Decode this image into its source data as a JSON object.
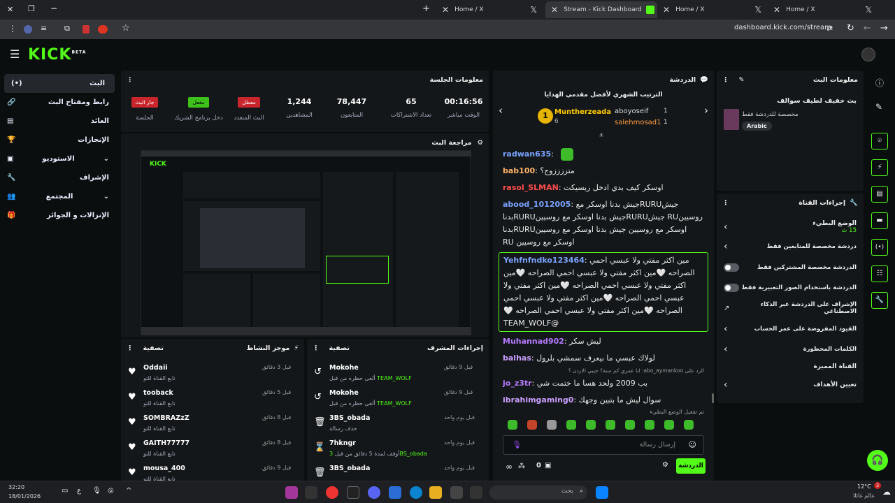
{
  "browser": {
    "tabs": [
      {
        "label": "Home / X"
      },
      {
        "label": "Stream - Kick Dashboard"
      },
      {
        "label": "Home / X"
      },
      {
        "label": "Home / X"
      }
    ],
    "url": "dashboard.kick.com/stream"
  },
  "kick": {
    "logo": "KICK",
    "logo_sup": "BETA"
  },
  "nav": [
    {
      "label": "البث",
      "icon": "broadcast-icon",
      "active": true
    },
    {
      "label": "رابط ومفتاح البث",
      "icon": "link-icon"
    },
    {
      "label": "العائد",
      "icon": "money-icon"
    },
    {
      "label": "الإنجازات",
      "icon": "trophy-icon"
    },
    {
      "label": "الاستوديو",
      "icon": "studio-icon"
    },
    {
      "label": "الإشراف",
      "icon": "wrench-icon"
    },
    {
      "label": "المجتمع",
      "icon": "community-icon"
    },
    {
      "label": "الإنزالات و الجوائز",
      "icon": "gift-icon"
    }
  ],
  "session": {
    "title": "معلومات الجلسة",
    "stats": [
      {
        "value": "00:16:56",
        "label": "الوقت مباشر"
      },
      {
        "value": "65",
        "label": "تعداد الاشتراكات"
      },
      {
        "value": "78,447",
        "label": "المتابعون"
      },
      {
        "value": "1,244",
        "label": "المشاهدين"
      },
      {
        "badge": "معطل",
        "label": "البث المتعدد"
      },
      {
        "badge": "مفعل",
        "label": "دخل برنامج الشريك"
      },
      {
        "badge": "جار البث",
        "label": "الجلسة"
      }
    ]
  },
  "preview": {
    "title": "مراجعة البث"
  },
  "chat": {
    "title": "الدردشة",
    "leaderboard_title": "الترتيب الشهري لأفضل مقدمي الهدايا",
    "leaders": [
      {
        "name": "Muntherzeada",
        "count": "6",
        "rank": "1"
      },
      {
        "name": "aboyoseif",
        "count": "1"
      },
      {
        "name": "salehmosad1",
        "count": "1"
      }
    ],
    "messages": [
      {
        "user": "radwan635",
        "color": "#7aa2ff",
        "text": ""
      },
      {
        "user": "bab100",
        "color": "#ffb36b",
        "text": "متززززوج؟"
      },
      {
        "user": "rasol_SLMAN",
        "color": "#ff4d4d",
        "text": "اوسكر كيف بدي ادخل ريسيكت"
      },
      {
        "user": "abood_1012005",
        "color": "#7aa2ff",
        "text": "جيشRURUجيش بدنا اوسكر مع روسيينRU جيشRURUجيش بدنا اوسكر مع روسيينRURUبدنا اوسكر مع روسيين جيش بدنا اوسكر مع روسيينRURUبدنا اوسكر مع روسيين RU"
      },
      {
        "user": "Yehfnfndko123464",
        "color": "#7aa2ff",
        "text": "مين اكثر مفتي ولا عبسي احمي الصراحه 🤍مين اكثر مفتي ولا عبسي احمي الصراحه 🤍مين اكثر مفتي ولا عبسي احمي الصراحه 🤍مين اكثر مفتي ولا عبسي احمي الصراحه 🤍مين اكثر مفتي ولا عبسي احمي الصراحه 🤍مين اكثر مفتي ولا عبسي احمي الصراحه 🤍 @TEAM_WOLF",
        "highlight": true
      },
      {
        "user": "Muhannad902",
        "color": "#b57bff",
        "text": "ليش سكر"
      },
      {
        "user": "balhas",
        "color": "#c9a0ff",
        "text": "لولاك عبسي ما بيعرف سمشي بلرول"
      },
      {
        "user": "jo_z3tr",
        "color": "#b57bff",
        "text": "بب 2009 ولحد هسا ما ختمت شي",
        "reply": "الرد على abo_aymankoo: انا عمري كم سنة؟ جيبي الاردن ؟"
      },
      {
        "user": "ibrahimgaming0",
        "color": "#c9a0ff",
        "text": "سوال ليش ما بتبين وجهك"
      }
    ],
    "slowmode_note": "تم تفعيل الوضع البطيء",
    "input_placeholder": "إرسال رسالة",
    "send_label": "الدردشة",
    "count": "0"
  },
  "stream_info": {
    "title": "معلومات البث",
    "stream_title": "بث خفيف لطيف سوالف",
    "category": "مخصصة للدردشة فقط",
    "language": "Arabic"
  },
  "channel_actions": {
    "title": "إجراءات القناة",
    "slow_mode": "الوضع البطيء",
    "slow_value": "15 ث",
    "items": [
      {
        "label": "دردشة مخصصة للمتابعين فقط",
        "type": "chevron"
      },
      {
        "label": "الدردشة مخصصة المشتركين فقط",
        "type": "switch"
      },
      {
        "label": "الدردشة باستخدام الصور التعبيرية فقط",
        "type": "switch"
      },
      {
        "label": "الإشراف على الدردشة عبر الذكاء الاصطناعي",
        "type": "external"
      },
      {
        "label": "القيود المفروضة على عمر الحساب",
        "type": "chevron"
      },
      {
        "label": "الكلمات المحظورة",
        "type": "chevron"
      }
    ],
    "goals_section": "القناة المميزة",
    "goals": "تعيين الأهداف"
  },
  "mod_actions": {
    "title": "إجراءات المشرف",
    "filter": "تصفية",
    "items": [
      {
        "user": "Mokohe",
        "desc": "ألغى حظره من قبل",
        "by": "TEAM_WOLF",
        "time": "قبل 9 دقائق",
        "icon": "undo-icon"
      },
      {
        "user": "Mokohe",
        "desc": "ألغى حظره من قبل",
        "by": "TEAM_WOLF",
        "time": "قبل 9 دقائق",
        "icon": "undo-icon"
      },
      {
        "user": "3BS_obada",
        "desc": "حذف رسالة",
        "by": "",
        "time": "قبل يوم واحد",
        "icon": "trash-icon"
      },
      {
        "user": "7hkngr",
        "desc": "أوقف لمدة 5 دقائق من قبل",
        "by": "3BS_obada",
        "time": "قبل يوم واحد",
        "icon": "hourglass-icon"
      },
      {
        "user": "3BS_obada",
        "desc": "",
        "by": "",
        "time": "قبل يوم واحد",
        "icon": "trash-icon"
      }
    ]
  },
  "activity": {
    "title": "موجز النشاط",
    "filter": "تصفية",
    "items": [
      {
        "user": "Oddaii",
        "desc": "تابع القناة للتو",
        "time": "قبل 3 دقائق"
      },
      {
        "user": "tooback",
        "desc": "تابع القناة للتو",
        "time": "قبل 5 دقائق"
      },
      {
        "user": "SOMBRAZzZ",
        "desc": "تابع القناة للتو",
        "time": "قبل 8 دقائق"
      },
      {
        "user": "GAITH77777",
        "desc": "تابع القناة للتو",
        "time": "قبل 8 دقائق"
      },
      {
        "user": "mousa_400",
        "desc": "تابع القناة للتو",
        "time": "قبل 9 دقائق"
      }
    ]
  },
  "taskbar": {
    "time": "32:20",
    "date": "18/01/2026",
    "lang": "ع",
    "search": "بحث",
    "temp": "12°C",
    "weather": "عالم غائلا",
    "notif": "3"
  }
}
